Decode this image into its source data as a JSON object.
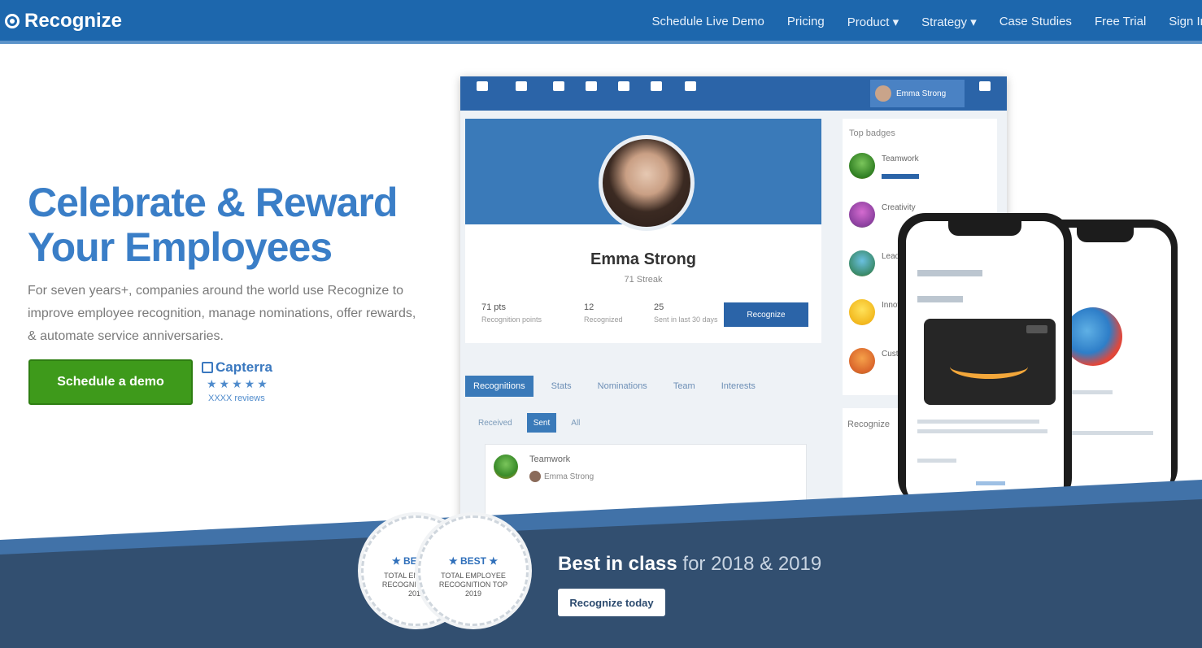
{
  "nav": {
    "logo": "Recognize",
    "links": [
      "Schedule Live Demo",
      "Pricing",
      "Product",
      "Strategy",
      "Case Studies",
      "Free Trial",
      "Sign In"
    ]
  },
  "hero": {
    "title_line1": "Celebrate & Reward",
    "title_line2": "Your Employees",
    "description": "For seven years+, companies around the world use Recognize to improve employee recognition, manage nominations, offer rewards, & automate service anniversaries.",
    "cta_label": "Schedule a demo",
    "capterra": {
      "name": "Capterra",
      "stars": "★★★★★",
      "reviews": "XXXX reviews"
    }
  },
  "mockup": {
    "profile_name": "Emma Strong",
    "profile_sub": "71 Streak",
    "stats": [
      {
        "value": "71 pts",
        "label": "Recognition points"
      },
      {
        "value": "12",
        "label": "Recognized"
      },
      {
        "value": "25",
        "label": "Sent in last 30 days"
      }
    ],
    "profile_button": "Recognize",
    "tabs": [
      "Recognitions",
      "Stats",
      "Nominations",
      "Team",
      "Interests"
    ],
    "subtabs": [
      "Received",
      "Sent",
      "All"
    ],
    "feed": {
      "title": "Teamwork",
      "user": "Emma Strong"
    },
    "side_title": "Top badges",
    "side_badges": [
      "Teamwork",
      "Creativity",
      "Leadership",
      "Innovation",
      "Customer"
    ],
    "side2_title": "Recognize",
    "user_chip": "Emma Strong"
  },
  "awards": {
    "line_bold": "Best in class",
    "line_rest": " for 2018 & 2019",
    "button_label": "Recognize today",
    "seal_top": "★ BEST ★",
    "seal_text": "TOTAL EMPLOYEE RECOGNITION TOP 2019"
  },
  "colors": {
    "nav_bg": "#1d67ad",
    "title_blue": "#3a7ec7",
    "cta_green": "#3e9a1b",
    "band_bg": "#324f70"
  }
}
